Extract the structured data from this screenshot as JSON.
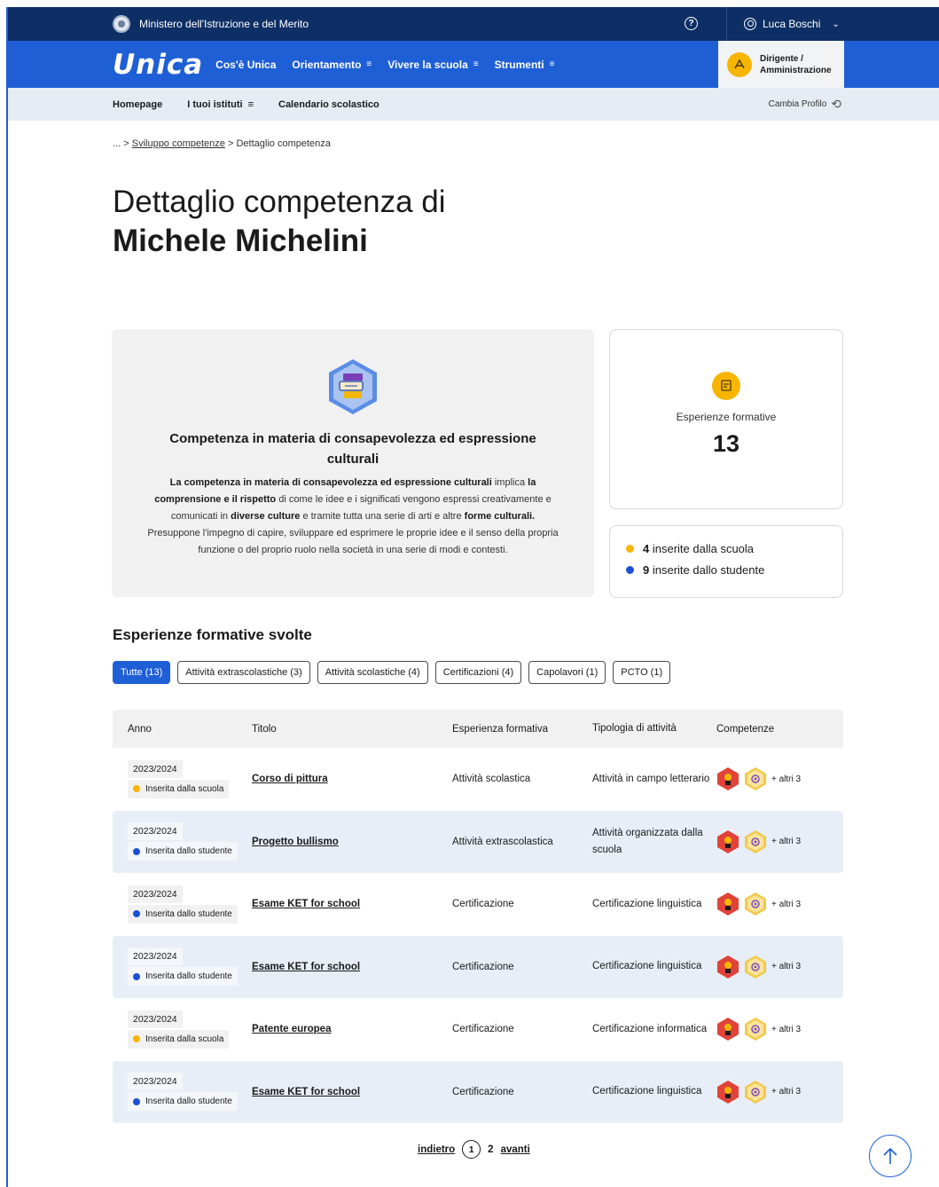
{
  "topbar": {
    "ministry": "Ministero dell'Istruzione e del Merito",
    "help_icon": "?",
    "user_name": "Luca Boschi"
  },
  "navbar": {
    "logo": "Unica",
    "links": [
      "Cos'è Unica",
      "Orientamento",
      "Vivere la scuola",
      "Strumenti"
    ],
    "role_line1": "Dirigente /",
    "role_line2": "Amministrazione"
  },
  "subnav": {
    "items": [
      "Homepage",
      "I tuoi istituti",
      "Calendario scolastico"
    ],
    "profile": "Cambia Profilo"
  },
  "breadcrumb": {
    "ellipsis": "...",
    "sep": ">",
    "parent": "Sviluppo competenze",
    "current": "Dettaglio competenza"
  },
  "page": {
    "title_line1": "Dettaglio competenza di",
    "title_name": "Michele Michelini"
  },
  "competence": {
    "title": "Competenza in materia di consapevolezza ed espressione culturali",
    "desc_b1": "La competenza in materia di consapevolezza ed espressione culturali",
    "desc_t1": " implica ",
    "desc_b2": "la comprensione e il rispetto",
    "desc_t2": " di come le idee e i significati vengono espressi creativamente e comunicati in ",
    "desc_b3": "diverse culture",
    "desc_t3": " e tramite tutta una serie di arti e altre ",
    "desc_b4": "forme culturali.",
    "desc_t4": " Presuppone l'impegno di capire, sviluppare ed esprimere le proprie idee e il senso della propria funzione o del proprio ruolo nella società in una serie di modi e contesti."
  },
  "stats": {
    "label": "Esperienze formative",
    "value": "13",
    "school_count": "4",
    "school_label": " inserite dalla scuola",
    "student_count": "9",
    "student_label": " inserite dallo studente"
  },
  "section_title": "Esperienze formative svolte",
  "filters": [
    "Tutte (13)",
    "Attività extrascolastiche (3)",
    "Attività scolastiche (4)",
    "Certificazioni (4)",
    "Capolavori (1)",
    "PCTO (1)"
  ],
  "table": {
    "headers": [
      "Anno",
      "Titolo",
      "Esperienza formativa",
      "Tipologia di attività",
      "Competenze"
    ],
    "rows": [
      {
        "year": "2023/2024",
        "origin": "Inserita dalla scuola",
        "title": "Corso di pittura",
        "experience": "Attività scolastica",
        "type": "Attività in campo letterario",
        "more": "+ altri 3"
      },
      {
        "year": "2023/2024",
        "origin": "Inserita dallo studente",
        "title": "Progetto bullismo",
        "experience": "Attività extrascolastica",
        "type": "Attività organizzata dalla scuola",
        "more": "+ altri 3"
      },
      {
        "year": "2023/2024",
        "origin": "Inserita dallo studente",
        "title": "Esame KET for school",
        "experience": "Certificazione",
        "type": "Certificazione linguistica",
        "more": "+ altri 3"
      },
      {
        "year": "2023/2024",
        "origin": "Inserita dallo studente",
        "title": "Esame KET for school",
        "experience": "Certificazione",
        "type": "Certificazione linguistica",
        "more": "+ altri 3"
      },
      {
        "year": "2023/2024",
        "origin": "Inserita dalla scuola",
        "title": "Patente europea",
        "experience": "Certificazione",
        "type": "Certificazione informatica",
        "more": "+ altri 3"
      },
      {
        "year": "2023/2024",
        "origin": "Inserita dallo studente",
        "title": "Esame KET for school",
        "experience": "Certificazione",
        "type": "Certificazione linguistica",
        "more": "+ altri 3"
      }
    ]
  },
  "pagination": {
    "prev": "indietro",
    "current": "1",
    "next_page": "2",
    "next": "avanti"
  },
  "colors": {
    "primary": "#1f5fd6",
    "header_dark": "#0e2f66",
    "school_dot": "#f7b500",
    "student_dot": "#1f4fd6"
  }
}
